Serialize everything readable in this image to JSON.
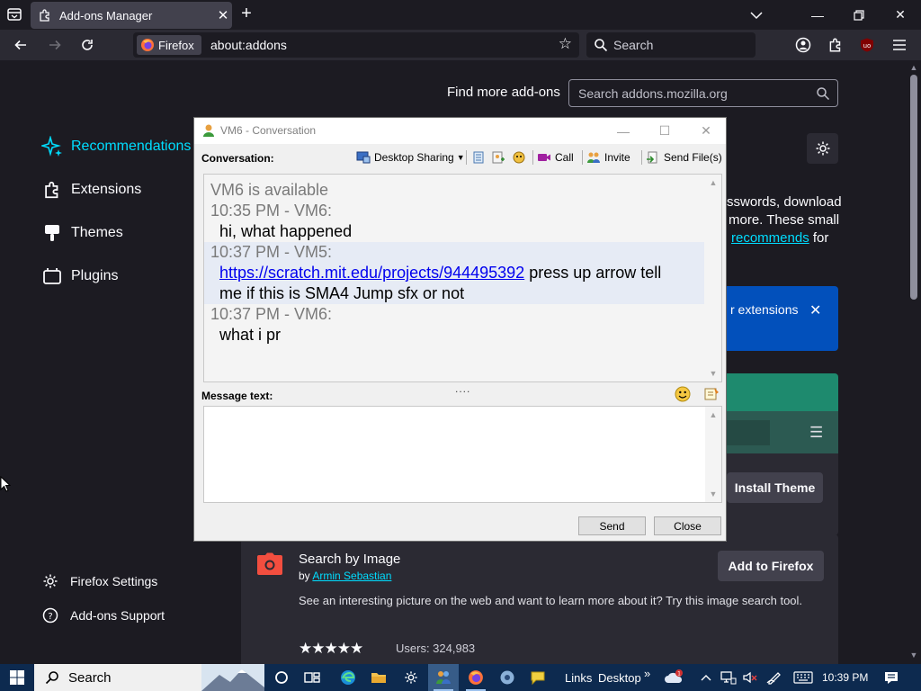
{
  "browser": {
    "tab_title": "Add-ons Manager",
    "identity_label": "Firefox",
    "url": "about:addons",
    "search_placeholder": "Search"
  },
  "page": {
    "find_more_label": "Find more add-ons",
    "amo_search_placeholder": "Search addons.mozilla.org",
    "categories": [
      {
        "label": "Recommendations",
        "icon": "sparkle-icon",
        "active": true
      },
      {
        "label": "Extensions",
        "icon": "puzzle-icon"
      },
      {
        "label": "Themes",
        "icon": "brush-icon"
      },
      {
        "label": "Plugins",
        "icon": "plugin-icon"
      }
    ],
    "sidebar_footer": [
      {
        "label": "Firefox Settings",
        "icon": "gear-icon"
      },
      {
        "label": "Add-ons Support",
        "icon": "help-icon"
      }
    ],
    "intro_line1": "sswords, download",
    "intro_line2": "more. These small",
    "intro_link": "recommends",
    "intro_tail": " for",
    "banner_text": "r extensions",
    "install_theme_label": "Install Theme",
    "addon": {
      "name": "Search by Image",
      "by_prefix": "by ",
      "author": "Armin Sebastian",
      "description": "See an interesting picture on the web and want to learn more about it? Try this image search tool.",
      "rating": 4.5,
      "stars": "★★★★★",
      "users": "Users: 324,983",
      "add_label": "Add to Firefox"
    }
  },
  "dialog": {
    "title": "VM6 - Conversation",
    "conversation_label": "Conversation:",
    "toolbar": {
      "desktop_sharing": "Desktop Sharing",
      "call": "Call",
      "invite": "Invite",
      "send_files": "Send File(s)"
    },
    "history": {
      "status": "VM6 is available",
      "msg1_meta": "10:35 PM - VM6:",
      "msg1_text": "hi, what happened",
      "msg2_meta": "10:37 PM - VM5:",
      "msg2_link": "https://scratch.mit.edu/projects/944495392",
      "msg2_text_a": " press up arrow tell",
      "msg2_text_b": "me if this is SMA4 Jump sfx or not",
      "msg3_meta": "10:37 PM - VM6:",
      "msg3_text": "what i pr"
    },
    "message_text_label": "Message text:",
    "message_value": "",
    "send_label": "Send",
    "close_label": "Close",
    "grip": "...."
  },
  "taskbar": {
    "search_label": "Search",
    "links_label": "Links",
    "desktop_label": "Desktop",
    "overflow": "»",
    "weather_badge": "1",
    "time": "10:39 PM"
  }
}
